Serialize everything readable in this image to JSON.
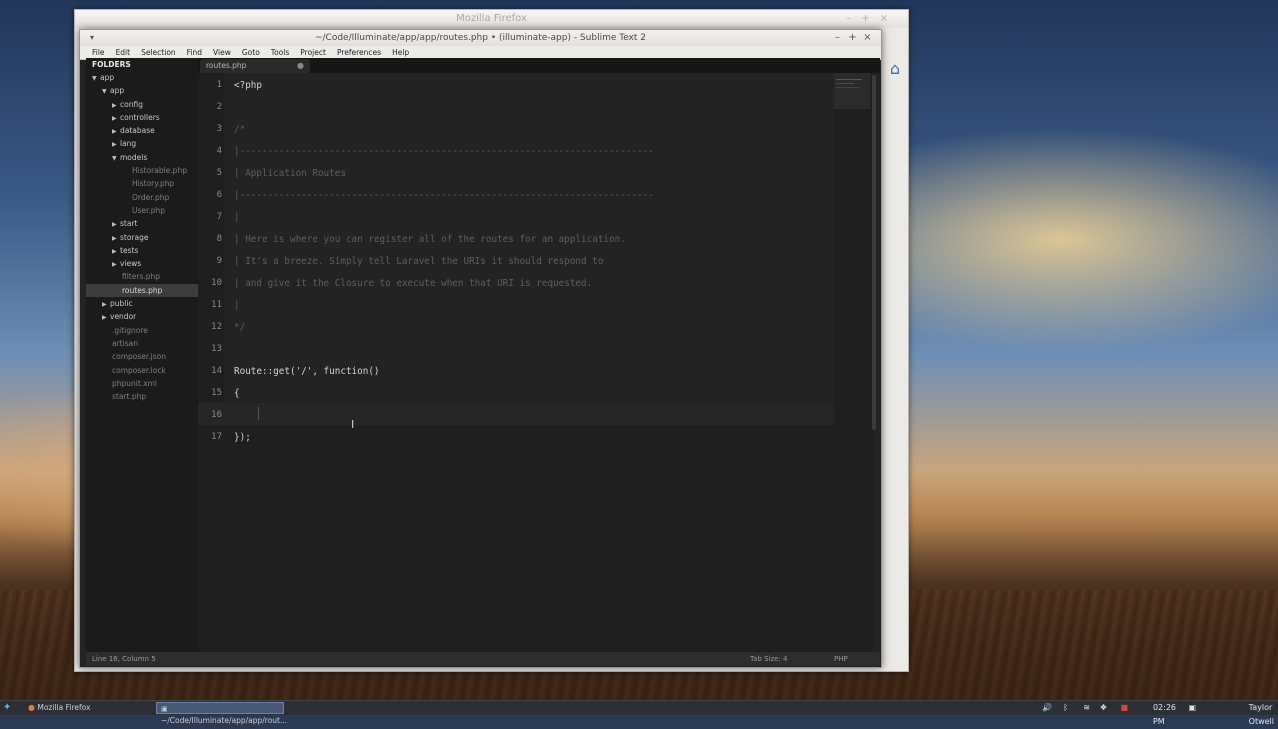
{
  "firefox": {
    "title": "Mozilla Firefox"
  },
  "sublime": {
    "title": "~/Code/Illuminate/app/app/routes.php • (illuminate-app) - Sublime Text 2",
    "menu": [
      "File",
      "Edit",
      "Selection",
      "Find",
      "View",
      "Goto",
      "Tools",
      "Project",
      "Preferences",
      "Help"
    ],
    "sidebar": {
      "header": "FOLDERS",
      "items": [
        {
          "label": "app",
          "depth": 0,
          "type": "folder",
          "expanded": true
        },
        {
          "label": "app",
          "depth": 1,
          "type": "folder",
          "expanded": true
        },
        {
          "label": "config",
          "depth": 2,
          "type": "folder",
          "expanded": false
        },
        {
          "label": "controllers",
          "depth": 2,
          "type": "folder",
          "expanded": false
        },
        {
          "label": "database",
          "depth": 2,
          "type": "folder",
          "expanded": false
        },
        {
          "label": "lang",
          "depth": 2,
          "type": "folder",
          "expanded": false
        },
        {
          "label": "models",
          "depth": 2,
          "type": "folder",
          "expanded": true
        },
        {
          "label": "Historable.php",
          "depth": 3,
          "type": "file"
        },
        {
          "label": "History.php",
          "depth": 3,
          "type": "file"
        },
        {
          "label": "Order.php",
          "depth": 3,
          "type": "file"
        },
        {
          "label": "User.php",
          "depth": 3,
          "type": "file"
        },
        {
          "label": "start",
          "depth": 2,
          "type": "folder",
          "expanded": false
        },
        {
          "label": "storage",
          "depth": 2,
          "type": "folder",
          "expanded": false
        },
        {
          "label": "tests",
          "depth": 2,
          "type": "folder",
          "expanded": false
        },
        {
          "label": "views",
          "depth": 2,
          "type": "folder",
          "expanded": false
        },
        {
          "label": "filters.php",
          "depth": 2,
          "type": "file"
        },
        {
          "label": "routes.php",
          "depth": 2,
          "type": "file",
          "selected": true
        },
        {
          "label": "public",
          "depth": 1,
          "type": "folder",
          "expanded": false
        },
        {
          "label": "vendor",
          "depth": 1,
          "type": "folder",
          "expanded": false
        },
        {
          "label": ".gitignore",
          "depth": 1,
          "type": "file"
        },
        {
          "label": "artisan",
          "depth": 1,
          "type": "file"
        },
        {
          "label": "composer.json",
          "depth": 1,
          "type": "file"
        },
        {
          "label": "composer.lock",
          "depth": 1,
          "type": "file"
        },
        {
          "label": "phpunit.xml",
          "depth": 1,
          "type": "file"
        },
        {
          "label": "start.php",
          "depth": 1,
          "type": "file"
        }
      ]
    },
    "tab": {
      "label": "routes.php",
      "dirty_marker": "●"
    },
    "code": [
      {
        "n": "1",
        "text": "<?php",
        "cls": ""
      },
      {
        "n": "2",
        "text": "",
        "cls": ""
      },
      {
        "n": "3",
        "text": "/*",
        "cls": "comment"
      },
      {
        "n": "4",
        "text": "|--------------------------------------------------------------------------",
        "cls": "comment"
      },
      {
        "n": "5",
        "text": "| Application Routes",
        "cls": "comment"
      },
      {
        "n": "6",
        "text": "|--------------------------------------------------------------------------",
        "cls": "comment"
      },
      {
        "n": "7",
        "text": "|",
        "cls": "comment"
      },
      {
        "n": "8",
        "text": "| Here is where you can register all of the routes for an application.",
        "cls": "comment"
      },
      {
        "n": "9",
        "text": "| It's a breeze. Simply tell Laravel the URIs it should respond to",
        "cls": "comment"
      },
      {
        "n": "10",
        "text": "| and give it the Closure to execute when that URI is requested.",
        "cls": "comment"
      },
      {
        "n": "11",
        "text": "|",
        "cls": "comment"
      },
      {
        "n": "12",
        "text": "*/",
        "cls": "comment"
      },
      {
        "n": "13",
        "text": "",
        "cls": ""
      },
      {
        "n": "14",
        "text": "Route::get('/', function()",
        "cls": ""
      },
      {
        "n": "15",
        "text": "{",
        "cls": ""
      },
      {
        "n": "16",
        "text": "",
        "cls": ""
      },
      {
        "n": "17",
        "text": "});",
        "cls": ""
      }
    ],
    "status": {
      "position": "Line 16, Column 5",
      "tab_size": "Tab Size: 4",
      "syntax": "PHP"
    }
  },
  "taskbar": {
    "tasks": [
      "Mozilla Firefox",
      "~/Code/Illuminate/app/app/rout..."
    ],
    "clock": "02:26 PM",
    "user": "Taylor Otwell"
  },
  "colors": {
    "accent": "#465a78",
    "editor_bg": "#1f1f1f",
    "comment": "#5e5e5e"
  }
}
